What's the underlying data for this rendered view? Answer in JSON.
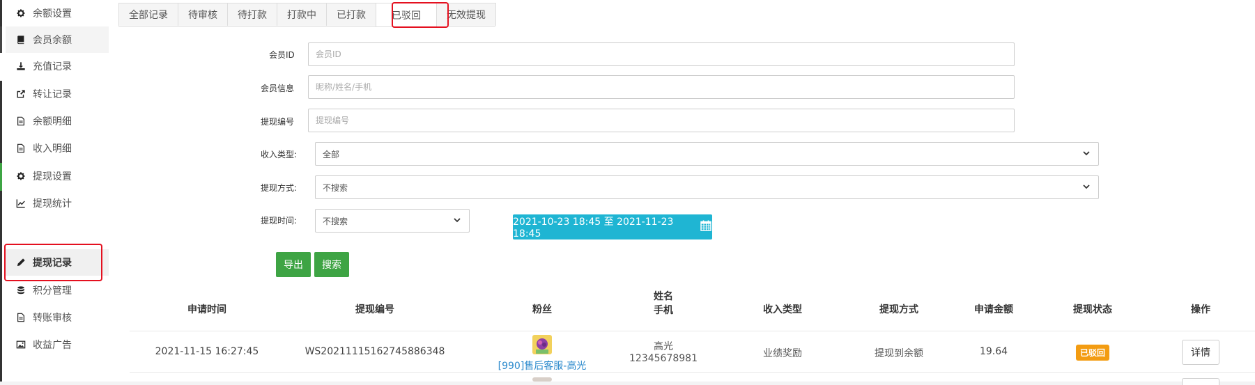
{
  "sidebar": {
    "items": [
      {
        "label": "余额设置",
        "icon": "gear-icon"
      },
      {
        "label": "会员余额",
        "icon": "book-icon"
      },
      {
        "label": "充值记录",
        "icon": "download-icon"
      },
      {
        "label": "转让记录",
        "icon": "external-link-icon"
      },
      {
        "label": "余额明细",
        "icon": "document-icon"
      },
      {
        "label": "收入明细",
        "icon": "document-icon"
      },
      {
        "label": "提现设置",
        "icon": "gear-icon"
      },
      {
        "label": "提现统计",
        "icon": "line-chart-icon"
      },
      {
        "label": "提现记录",
        "icon": "pencil-icon"
      },
      {
        "label": "积分管理",
        "icon": "database-icon"
      },
      {
        "label": "转账审核",
        "icon": "document-icon"
      },
      {
        "label": "收益广告",
        "icon": "image-icon"
      }
    ],
    "active_index": 8
  },
  "tabs": [
    {
      "label": "全部记录"
    },
    {
      "label": "待审核"
    },
    {
      "label": "待打款"
    },
    {
      "label": "打款中"
    },
    {
      "label": "已打款"
    },
    {
      "label": "已驳回"
    },
    {
      "label": "无效提现"
    }
  ],
  "active_tab": 5,
  "filters": {
    "member_id": {
      "label": "会员ID",
      "placeholder": "会员ID"
    },
    "member_info": {
      "label": "会员信息",
      "placeholder": "昵称/姓名/手机"
    },
    "withdraw_no": {
      "label": "提现编号",
      "placeholder": "提现编号"
    },
    "income_type": {
      "label": "收入类型:",
      "value": "全部"
    },
    "withdraw_method": {
      "label": "提现方式:",
      "value": "不搜索"
    },
    "withdraw_time": {
      "label": "提现时间:",
      "value": "不搜索"
    },
    "date_range": "2021-10-23 18:45 至 2021-11-23 18:45"
  },
  "buttons": {
    "export": "导出",
    "search": "搜索"
  },
  "table": {
    "headers": {
      "apply_time": "申请时间",
      "withdraw_no": "提现编号",
      "fan": "粉丝",
      "name": "姓名",
      "phone": "手机",
      "income_type": "收入类型",
      "method": "提现方式",
      "amount": "申请金额",
      "status": "提现状态",
      "action": "操作"
    },
    "rows": [
      {
        "apply_time": "2021-11-15 16:27:45",
        "withdraw_no": "WS20211115162745886348",
        "fan": "[990]售后客服-高光",
        "name": "高光",
        "phone": "12345678981",
        "income_type": "业绩奖励",
        "method": "提现到余额",
        "amount": "19.64",
        "status": "已驳回",
        "action": "详情"
      }
    ]
  },
  "colors": {
    "accent_info": "#1fb5d3",
    "accent_success": "#3ea444",
    "status_rejected": "#f39c12",
    "highlight": "#e4101f"
  }
}
